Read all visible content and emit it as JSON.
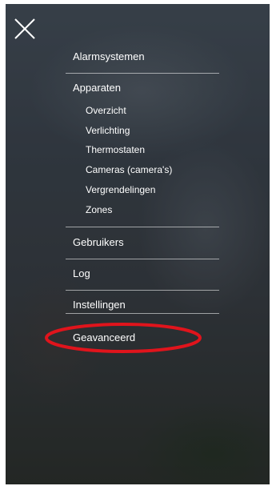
{
  "menu": {
    "alarm_systems": "Alarmsystemen",
    "devices": "Apparaten",
    "device_sub": [
      "Overzicht",
      "Verlichting",
      "Thermostaten",
      "Cameras (camera's)",
      "Vergrendelingen",
      "Zones"
    ],
    "users": "Gebruikers",
    "log": "Log",
    "settings": "Instellingen",
    "advanced": "Geavanceerd"
  },
  "icons": {
    "close": "close-icon"
  },
  "colors": {
    "text": "#ffffff",
    "highlight": "#e0141c"
  }
}
